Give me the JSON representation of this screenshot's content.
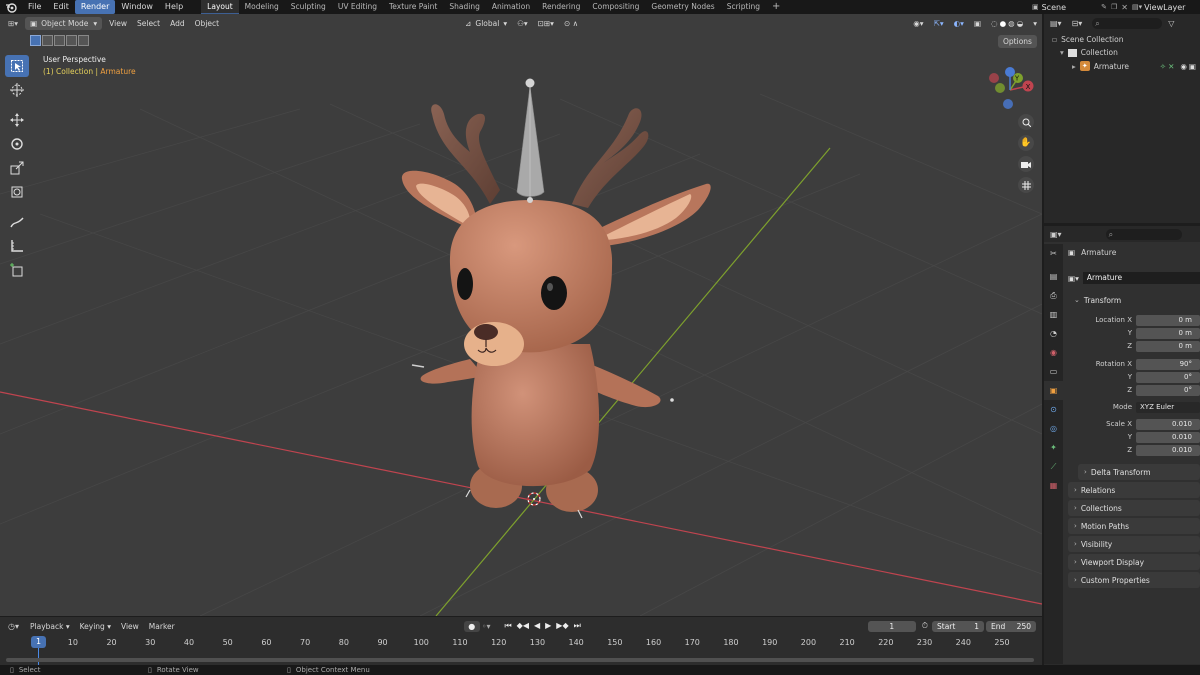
{
  "menu": {
    "blender_icon": "blender-logo-icon",
    "items": [
      "File",
      "Edit",
      "Render",
      "Window",
      "Help"
    ],
    "active": "Render"
  },
  "workspaces": {
    "tabs": [
      "Layout",
      "Modeling",
      "Sculpting",
      "UV Editing",
      "Texture Paint",
      "Shading",
      "Animation",
      "Rendering",
      "Compositing",
      "Geometry Nodes",
      "Scripting"
    ],
    "active": "Layout",
    "add": "+"
  },
  "scene": {
    "name": "Scene",
    "view_layer": "ViewLayer"
  },
  "viewport": {
    "mode": "Object Mode",
    "menu": [
      "View",
      "Select",
      "Add",
      "Object"
    ],
    "orientation": "Global",
    "options": "Options",
    "perspective": "User Perspective",
    "context_prefix": "(1) Collection | ",
    "context_object": "Armature",
    "gizmo": {
      "x": "X",
      "y": "Y",
      "z": "Z"
    },
    "colors": {
      "x_axis": "#c0444f",
      "y_axis": "#7ea12d",
      "z_axis": "#4a7bd4",
      "background": "#3d3d3d",
      "character": "#b2735a"
    }
  },
  "outliner": {
    "root": "Scene Collection",
    "collection": "Collection",
    "object": "Armature"
  },
  "properties": {
    "object_name": "Armature",
    "data_name": "Armature",
    "transform": {
      "title": "Transform",
      "location": {
        "label": "Location X",
        "x": "0 m",
        "y": "0 m",
        "z": "0 m"
      },
      "rotation": {
        "label": "Rotation X",
        "x": "90°",
        "y": "0°",
        "z": "0°"
      },
      "mode": {
        "label": "Mode",
        "value": "XYZ Euler"
      },
      "scale": {
        "label": "Scale X",
        "x": "0.010",
        "y": "0.010",
        "z": "0.010"
      },
      "y": "Y",
      "z": "Z"
    },
    "panels": [
      "Delta Transform",
      "Relations",
      "Collections",
      "Motion Paths",
      "Visibility",
      "Viewport Display",
      "Custom Properties"
    ]
  },
  "timeline": {
    "menu": [
      "Playback",
      "Keying",
      "View",
      "Marker"
    ],
    "current_frame": "1",
    "start_label": "Start",
    "start": "1",
    "end_label": "End",
    "end": "250",
    "ticks": [
      "1",
      "10",
      "20",
      "30",
      "40",
      "50",
      "60",
      "70",
      "80",
      "90",
      "100",
      "110",
      "120",
      "130",
      "140",
      "150",
      "160",
      "170",
      "180",
      "190",
      "200",
      "210",
      "220",
      "230",
      "240",
      "250"
    ]
  },
  "statusbar": {
    "select": "Select",
    "rotate": "Rotate View",
    "context": "Object Context Menu"
  }
}
